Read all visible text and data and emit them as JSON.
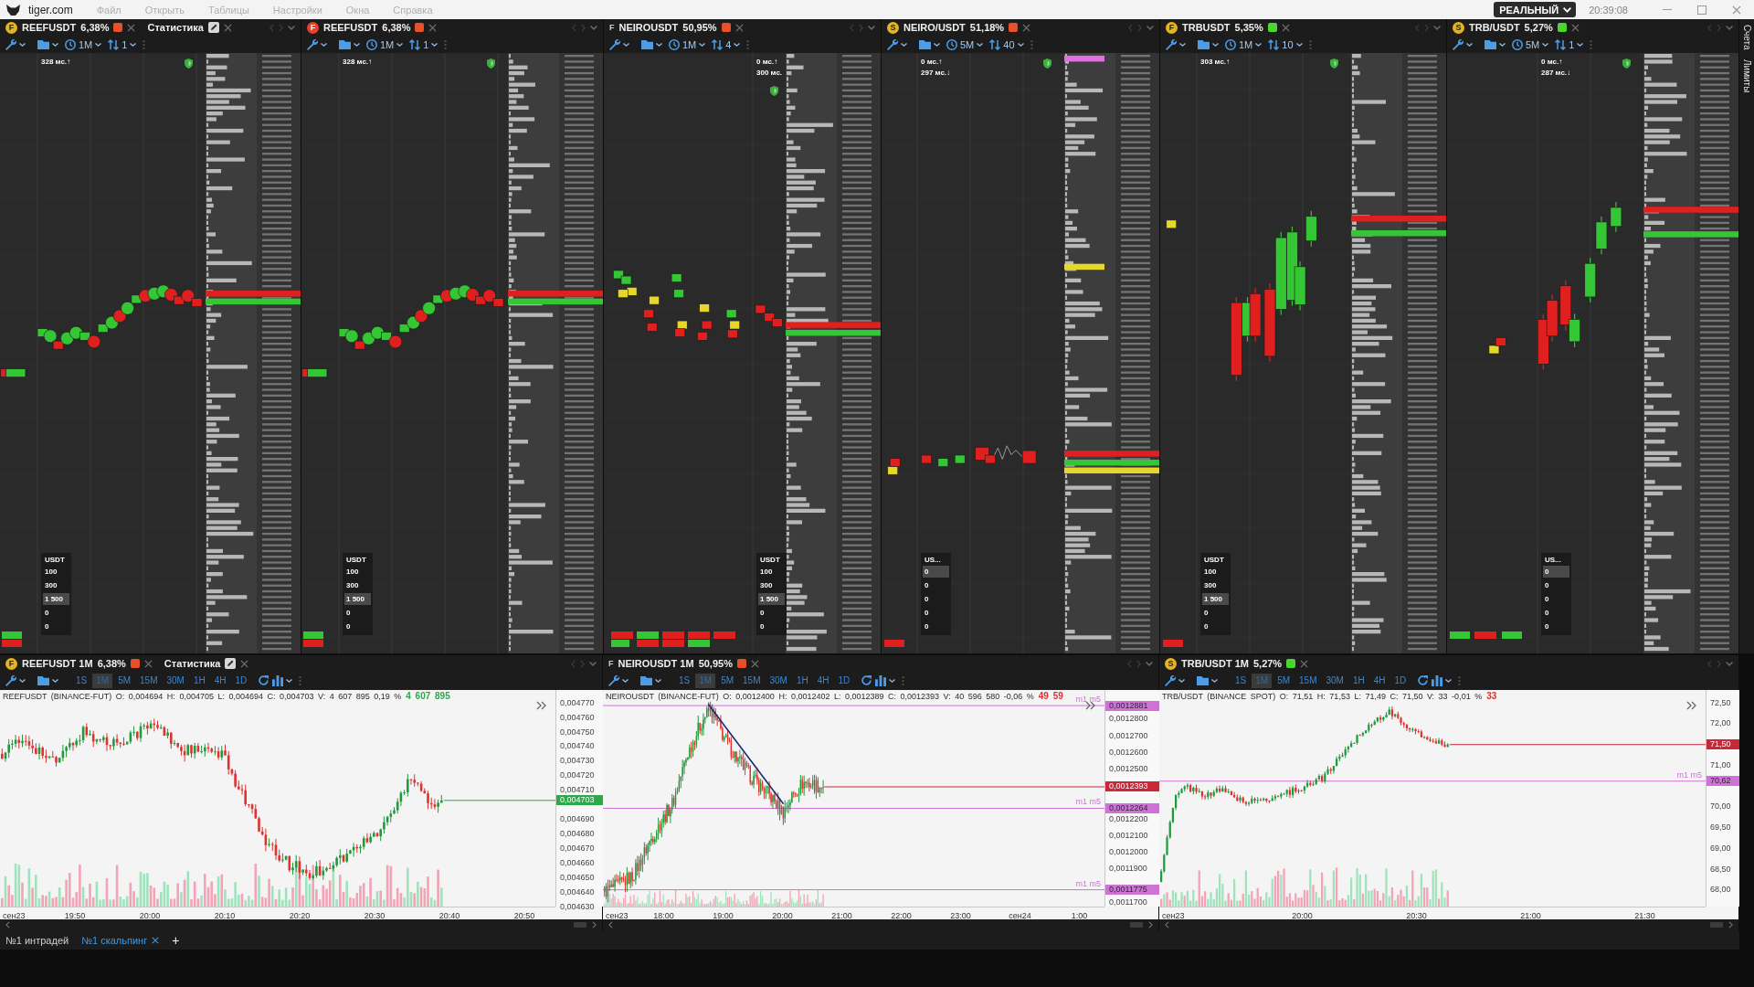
{
  "title_bar": {
    "logo": "tiger.com",
    "menu": [
      "Файл",
      "Открыть",
      "Таблицы",
      "Настройки",
      "Окна",
      "Справка"
    ],
    "account_mode": "РЕАЛЬНЫЙ",
    "clock": "20:39:08"
  },
  "side_tabs": [
    "Счета",
    "Лимиты"
  ],
  "scalping_panels": [
    {
      "badge": {
        "letter": "F",
        "color": "#e3b422"
      },
      "symbol": "REEFUSDT",
      "change": "6,38%",
      "color": "#e8502a",
      "extra_tab": "Статистика",
      "timeframe": "1M",
      "scale": "1",
      "latency": [
        "328 мс.↑"
      ],
      "widget": {
        "currency": "USDT",
        "amounts": [
          {
            "text": "100",
            "selected": false
          },
          {
            "text": "300",
            "selected": false
          },
          {
            "text": "1 500",
            "selected": true
          },
          {
            "text": "0",
            "selected": false
          },
          {
            "text": "0",
            "selected": false
          }
        ]
      }
    },
    {
      "badge": {
        "letter": "F",
        "color": "#e8402a"
      },
      "symbol": "REEFUSDT",
      "change": "6,38%",
      "color": "#e8502a",
      "timeframe": "1M",
      "scale": "1",
      "latency": [
        "328 мс.↑"
      ],
      "widget": {
        "currency": "USDT",
        "amounts": [
          {
            "text": "100",
            "selected": false
          },
          {
            "text": "300",
            "selected": false
          },
          {
            "text": "1 500",
            "selected": true
          },
          {
            "text": "0",
            "selected": false
          },
          {
            "text": "0",
            "selected": false
          }
        ]
      }
    },
    {
      "badge": {
        "letter": "F"
      },
      "symbol": "NEIROUSDT",
      "change": "50,95%",
      "color": "#e8502a",
      "timeframe": "1M",
      "scale": "4",
      "latency": [
        "0 мс.↑",
        "300 мс."
      ],
      "widget": {
        "currency": "USDT",
        "amounts": [
          {
            "text": "100",
            "selected": false
          },
          {
            "text": "300",
            "selected": false
          },
          {
            "text": "1 500",
            "selected": true
          },
          {
            "text": "0",
            "selected": false
          },
          {
            "text": "0",
            "selected": false
          }
        ]
      }
    },
    {
      "badge": {
        "letter": "S",
        "color": "#e3b422"
      },
      "symbol": "NEIRO/USDT",
      "change": "51,18%",
      "color": "#e8502a",
      "timeframe": "5M",
      "scale": "40",
      "latency": [
        "0 мс.↑",
        "297 мс.↓"
      ],
      "widget": {
        "currency": "US...",
        "amounts": [
          {
            "text": "0",
            "selected": true
          },
          {
            "text": "0",
            "selected": false
          },
          {
            "text": "0",
            "selected": false
          },
          {
            "text": "0",
            "selected": false
          },
          {
            "text": "0",
            "selected": false
          }
        ]
      }
    },
    {
      "badge": {
        "letter": "F",
        "color": "#e3b422"
      },
      "symbol": "TRBUSDT",
      "change": "5,35%",
      "color": "#49d62e",
      "timeframe": "1M",
      "scale": "10",
      "latency": [
        "303 мс.↑"
      ],
      "widget": {
        "currency": "USDT",
        "amounts": [
          {
            "text": "100",
            "selected": false
          },
          {
            "text": "300",
            "selected": false
          },
          {
            "text": "1 500",
            "selected": true
          },
          {
            "text": "0",
            "selected": false
          },
          {
            "text": "0",
            "selected": false
          }
        ]
      }
    },
    {
      "badge": {
        "letter": "S",
        "color": "#e3b422"
      },
      "symbol": "TRB/USDT",
      "change": "5,27%",
      "color": "#49d62e",
      "timeframe": "5M",
      "scale": "1",
      "latency": [
        "0 мс.↑",
        "287 мс.↓"
      ],
      "widget": {
        "currency": "US...",
        "amounts": [
          {
            "text": "0",
            "selected": true
          },
          {
            "text": "0",
            "selected": false
          },
          {
            "text": "0",
            "selected": false
          },
          {
            "text": "0",
            "selected": false
          },
          {
            "text": "0",
            "selected": false
          }
        ]
      }
    }
  ],
  "chart_panels": [
    {
      "badge": {
        "letter": "F",
        "color": "#e3b422"
      },
      "title": "REEFUSDT 1M",
      "change": "6,38%",
      "color": "#e8502a",
      "extra_tab": "Статистика",
      "timeframes": [
        {
          "label": "1S",
          "selected": false
        },
        {
          "label": "1M",
          "selected": true
        },
        {
          "label": "5M",
          "selected": false
        },
        {
          "label": "15M",
          "selected": false
        },
        {
          "label": "30M",
          "selected": false
        },
        {
          "label": "1H",
          "selected": false
        },
        {
          "label": "4H",
          "selected": false
        },
        {
          "label": "1D",
          "selected": false
        }
      ],
      "info": "REEFUSDT (BINANCE-FUT) O: 0,004694 H: 0,004705 L: 0,004694 C: 0,004703 V: 4 607 895 0,19 %",
      "volume_delta": {
        "text": "4 607 895",
        "color": "#2ea84a"
      },
      "price_axis": [
        {
          "text": "0,004770",
          "kind": "tick"
        },
        {
          "text": "0,004760",
          "kind": "tick"
        },
        {
          "text": "0,004750",
          "kind": "tick"
        },
        {
          "text": "0,004740",
          "kind": "tick"
        },
        {
          "text": "0,004730",
          "kind": "tick"
        },
        {
          "text": "0,004720",
          "kind": "tick"
        },
        {
          "text": "0,004710",
          "kind": "tick"
        },
        {
          "text": "0,004703",
          "kind": "last",
          "color": "#2ea84a"
        },
        {
          "text": "0,004690",
          "kind": "tick"
        },
        {
          "text": "0,004680",
          "kind": "tick"
        },
        {
          "text": "0,004670",
          "kind": "tick"
        },
        {
          "text": "0,004660",
          "kind": "tick"
        },
        {
          "text": "0,004650",
          "kind": "tick"
        },
        {
          "text": "0,004640",
          "kind": "tick"
        },
        {
          "text": "0,004630",
          "kind": "tick"
        }
      ],
      "time_axis": [
        "сен23",
        "19:50",
        "20:00",
        "20:10",
        "20:20",
        "20:30",
        "20:40",
        "20:50"
      ]
    },
    {
      "badge": {
        "letter": "F"
      },
      "title": "NEIROUSDT 1M",
      "change": "50,95%",
      "color": "#e8502a",
      "timeframes": [
        {
          "label": "1S",
          "selected": false
        },
        {
          "label": "1M",
          "selected": true
        },
        {
          "label": "5M",
          "selected": false
        },
        {
          "label": "15M",
          "selected": false
        },
        {
          "label": "30M",
          "selected": false
        },
        {
          "label": "1H",
          "selected": false
        },
        {
          "label": "4H",
          "selected": false
        },
        {
          "label": "1D",
          "selected": false
        }
      ],
      "info": "NEIROUSDT (BINANCE-FUT) O: 0,0012400 H: 0,0012402 L: 0,0012389 C: 0,0012393 V: 40 596 580 -0,06 %",
      "volume_delta": {
        "text": "49 59",
        "color": "#e03030"
      },
      "price_axis": [
        {
          "text": "0,0012881",
          "kind": "level",
          "color": "#cf72d6",
          "line_label": "m1 m5"
        },
        {
          "text": "0,0012800",
          "kind": "tick"
        },
        {
          "text": "0,0012700",
          "kind": "tick"
        },
        {
          "text": "0,0012600",
          "kind": "tick"
        },
        {
          "text": "0,0012500",
          "kind": "tick"
        },
        {
          "text": "0,0012393",
          "kind": "last",
          "color": "#c62a3a"
        },
        {
          "text": "0,0012264",
          "kind": "level",
          "color": "#cf72d6",
          "line_label": "m1 m5"
        },
        {
          "text": "0,0012200",
          "kind": "tick"
        },
        {
          "text": "0,0012100",
          "kind": "tick"
        },
        {
          "text": "0,0012000",
          "kind": "tick"
        },
        {
          "text": "0,0011900",
          "kind": "tick"
        },
        {
          "text": "0,0011775",
          "kind": "level",
          "color": "#cf72d6",
          "line_label": "m1 m5"
        },
        {
          "text": "0,0011700",
          "kind": "tick"
        }
      ],
      "time_axis": [
        "сен23",
        "18:00",
        "19:00",
        "20:00",
        "21:00",
        "22:00",
        "23:00",
        "сен24",
        "1:00"
      ]
    },
    {
      "badge": {
        "letter": "S",
        "color": "#e3b422"
      },
      "title": "TRB/USDT 1M",
      "change": "5,27%",
      "color": "#49d62e",
      "timeframes": [
        {
          "label": "1S",
          "selected": false
        },
        {
          "label": "1M",
          "selected": true
        },
        {
          "label": "5M",
          "selected": false
        },
        {
          "label": "15M",
          "selected": false
        },
        {
          "label": "30M",
          "selected": false
        },
        {
          "label": "1H",
          "selected": false
        },
        {
          "label": "4H",
          "selected": false
        },
        {
          "label": "1D",
          "selected": false
        }
      ],
      "info": "TRB/USDT (BINANCE SPOT) O: 71,51 H: 71,53 L: 71,49 C: 71,50 V: 33 -0,01 %",
      "volume_delta": {
        "text": "33",
        "color": "#e03030"
      },
      "price_axis": [
        {
          "text": "72,50",
          "kind": "tick"
        },
        {
          "text": "72,00",
          "kind": "tick"
        },
        {
          "text": "71,50",
          "kind": "last",
          "color": "#c62a3a"
        },
        {
          "text": "71,00",
          "kind": "tick"
        },
        {
          "text": "70,62",
          "kind": "level",
          "color": "#cf72d6",
          "line_label": "m1 m5"
        },
        {
          "text": "70,00",
          "kind": "tick"
        },
        {
          "text": "69,50",
          "kind": "tick"
        },
        {
          "text": "69,00",
          "kind": "tick"
        },
        {
          "text": "68,50",
          "kind": "tick"
        },
        {
          "text": "68,00",
          "kind": "tick"
        }
      ],
      "time_axis": [
        "сен23",
        "20:00",
        "20:30",
        "21:00",
        "21:30"
      ]
    }
  ],
  "workspace_tabs": [
    {
      "label": "№1 интрадей",
      "selected": false
    },
    {
      "label": "№1 скальпинг",
      "selected": true
    }
  ],
  "add_tab": "+"
}
